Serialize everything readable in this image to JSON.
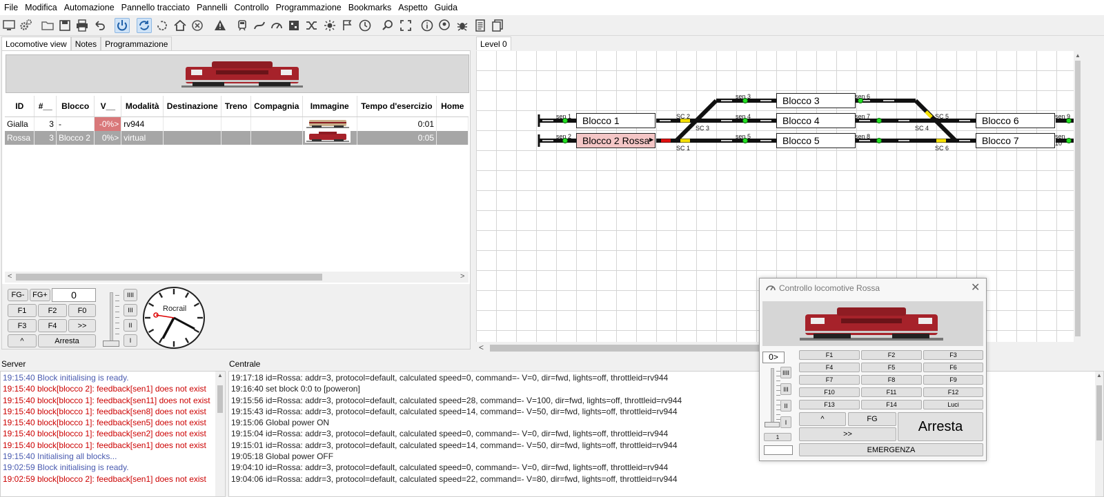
{
  "menu": [
    "File",
    "Modifica",
    "Automazione",
    "Pannello tracciato",
    "Pannelli",
    "Controllo",
    "Programmazione",
    "Bookmarks",
    "Aspetto",
    "Guida"
  ],
  "toolbar_icons": [
    "monitor-icon",
    "gears-icon",
    "open-folder-icon",
    "save-icon",
    "print-icon",
    "undo-icon",
    "power-icon",
    "auto-cycle-icon",
    "refresh-icon",
    "home-icon",
    "stop-circle-icon",
    "warning-icon",
    "train-icon",
    "route-icon",
    "throttle-icon",
    "cube-icon",
    "shuffle-icon",
    "light-icon",
    "flags-icon",
    "clock-icon",
    "search-icon",
    "fullscreen-icon",
    "info-icon",
    "chat-icon",
    "bug-icon",
    "list-icon",
    "documents-icon"
  ],
  "left_tabs": [
    "Locomotive view",
    "Notes",
    "Programmazione"
  ],
  "right_tabs": [
    "Level 0"
  ],
  "loco_table": {
    "headers": [
      "ID",
      "#__",
      "Blocco",
      "V__",
      "Modalità",
      "Destinazione",
      "Treno",
      "Compagnia",
      "Immagine",
      "Tempo d'esercizio",
      "Home"
    ],
    "rows": [
      {
        "id": "Gialla",
        "addr": "3",
        "block": "-",
        "v": "-0%>",
        "mode": "rv944",
        "time": "0:01"
      },
      {
        "id": "Rossa",
        "addr": "3",
        "block": "Blocco 2",
        "v": "0%>",
        "mode": "virtual",
        "time": "0:05"
      }
    ]
  },
  "throttle_left": {
    "fg_minus": "FG-",
    "fg_plus": "FG+",
    "value": "0",
    "f1": "F1",
    "f2": "F2",
    "f0": "F0",
    "f3": "F3",
    "f4": "F4",
    "next": ">>",
    "up": "^",
    "stop": "Arresta",
    "gears": [
      "IIII",
      "III",
      "II",
      "I"
    ]
  },
  "clock_logo": "Rocrail",
  "track": {
    "blocks": [
      {
        "name": "Blocco 1",
        "occupied": false
      },
      {
        "name": "Blocco 2 Rossa",
        "occupied": true
      },
      {
        "name": "Blocco 3",
        "occupied": false
      },
      {
        "name": "Blocco 4",
        "occupied": false
      },
      {
        "name": "Blocco 5",
        "occupied": false
      },
      {
        "name": "Blocco 6",
        "occupied": false
      },
      {
        "name": "Blocco 7",
        "occupied": false
      }
    ],
    "labels": [
      "sen 1",
      "sen 2",
      "sen 3",
      "sen 4",
      "sen 5",
      "sen 6",
      "sen 7",
      "sen 8",
      "sen 9",
      "sen 10",
      "SC 2",
      "SC 3",
      "SC 1",
      "SC 5",
      "SC 4",
      "SC 6"
    ]
  },
  "server_label": "Server",
  "central_label": "Centrale",
  "server_log": [
    {
      "t": "19:15:40 Block initialising is ready.",
      "k": "info"
    },
    {
      "t": "19:15:40 block[blocco 2]: feedback[sen1] does not exist",
      "k": "err"
    },
    {
      "t": "19:15:40 block[blocco 1]: feedback[sen11] does not exist",
      "k": "err"
    },
    {
      "t": "19:15:40 block[blocco 1]: feedback[sen8] does not exist",
      "k": "err"
    },
    {
      "t": "19:15:40 block[blocco 1]: feedback[sen5] does not exist",
      "k": "err"
    },
    {
      "t": "19:15:40 block[blocco 1]: feedback[sen2] does not exist",
      "k": "err"
    },
    {
      "t": "19:15:40 block[blocco 1]: feedback[sen1] does not exist",
      "k": "err"
    },
    {
      "t": "19:15:40 Initialising all blocks...",
      "k": "info"
    },
    {
      "t": "19:02:59 Block initialising is ready.",
      "k": "info"
    },
    {
      "t": "19:02:59 block[blocco 2]: feedback[sen1] does not exist",
      "k": "err"
    }
  ],
  "central_log": [
    "19:17:18 id=Rossa: addr=3, protocol=default, calculated speed=0, command=- V=0, dir=fwd, lights=off, throttleid=rv944",
    "19:16:40 set block 0:0 to [poweron]",
    "19:15:56 id=Rossa: addr=3, protocol=default, calculated speed=28, command=- V=100, dir=fwd, lights=off, throttleid=rv944",
    "19:15:43 id=Rossa: addr=3, protocol=default, calculated speed=14, command=- V=50, dir=fwd, lights=off, throttleid=rv944",
    "19:15:06 Global power ON",
    "19:15:04 id=Rossa: addr=3, protocol=default, calculated speed=0, command=- V=0, dir=fwd, lights=off, throttleid=rv944",
    "19:15:01 id=Rossa: addr=3, protocol=default, calculated speed=14, command=- V=50, dir=fwd, lights=off, throttleid=rv944",
    "19:05:18 Global power OFF",
    "19:04:10 id=Rossa: addr=3, protocol=default, calculated speed=0, command=- V=0, dir=fwd, lights=off, throttleid=rv944",
    "19:04:06 id=Rossa: addr=3, protocol=default, calculated speed=22, command=- V=80, dir=fwd, lights=off, throttleid=rv944"
  ],
  "dialog": {
    "title": "Controllo locomotive Rossa",
    "speed": "0>",
    "fkeys": [
      "F1",
      "F2",
      "F3",
      "F4",
      "F5",
      "F6",
      "F7",
      "F8",
      "F9",
      "F10",
      "F11",
      "F12",
      "F13",
      "F14",
      "Luci"
    ],
    "up": "^",
    "fg": "FG",
    "stop": "Arresta",
    "next": ">>",
    "emergency": "EMERGENZA",
    "gears": [
      "IIII",
      "III",
      "II",
      "I"
    ],
    "step": "1"
  },
  "colors": {
    "accent": "#cfe3f7",
    "occupied": "#f4c6c6",
    "error": "#cc0000",
    "info": "#4a5bb0",
    "sensor": "#22dd22"
  }
}
